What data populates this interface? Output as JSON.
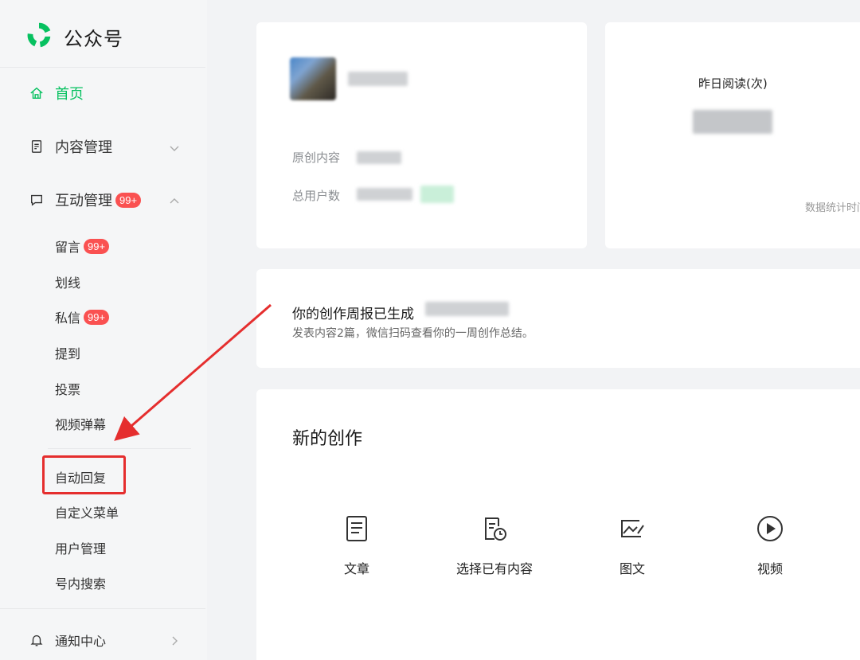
{
  "app": {
    "name": "公众号"
  },
  "sidebar": {
    "home": "首页",
    "content_mgmt": "内容管理",
    "interaction_mgmt": "互动管理",
    "interaction_badge": "99+",
    "sub_items": [
      {
        "label": "留言",
        "badge": "99+"
      },
      {
        "label": "划线"
      },
      {
        "label": "私信",
        "badge": "99+"
      },
      {
        "label": "提到"
      },
      {
        "label": "投票"
      },
      {
        "label": "视频弹幕"
      },
      {
        "label": "自动回复"
      },
      {
        "label": "自定义菜单"
      },
      {
        "label": "用户管理"
      },
      {
        "label": "号内搜索"
      }
    ],
    "notification_center": "通知中心"
  },
  "profile_card": {
    "original_content_label": "原创内容",
    "total_users_label": "总用户数"
  },
  "stats_card": {
    "yesterday_reads_label": "昨日阅读(次)",
    "footnote": "数据统计时间"
  },
  "report_card": {
    "title": "你的创作周报已生成",
    "description": "发表内容2篇，微信扫码查看你的一周创作总结。"
  },
  "create_card": {
    "title": "新的创作",
    "items": [
      {
        "label": "文章",
        "icon": "article-icon"
      },
      {
        "label": "选择已有内容",
        "icon": "existing-content-icon"
      },
      {
        "label": "图文",
        "icon": "image-text-icon"
      },
      {
        "label": "视频",
        "icon": "video-play-icon"
      }
    ]
  },
  "colors": {
    "brand": "#07c160",
    "badge": "#fa5151",
    "annotation": "#e52e2e"
  }
}
